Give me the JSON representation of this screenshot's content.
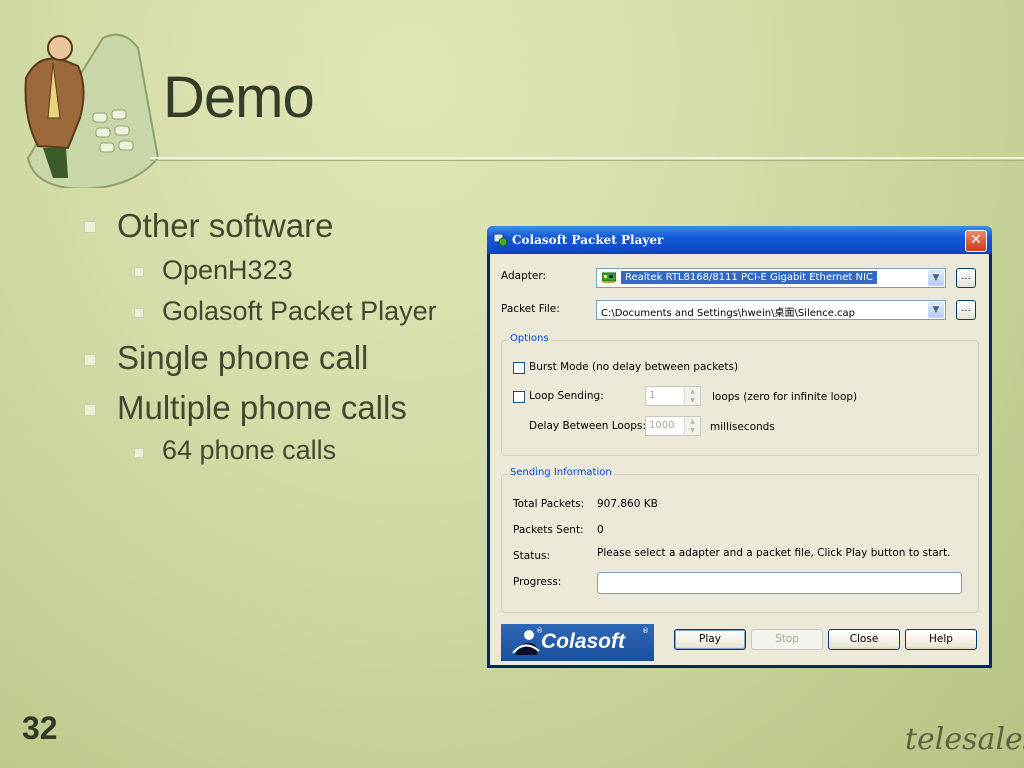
{
  "slide": {
    "title": "Demo",
    "page_number": "32",
    "brand": "telesales",
    "bullets": [
      {
        "text": "Other software",
        "children": [
          "OpenH323",
          "Golasoft Packet Player"
        ]
      },
      {
        "text": "Single phone call",
        "children": []
      },
      {
        "text": "Multiple phone calls",
        "children": [
          "64 phone calls"
        ]
      }
    ]
  },
  "dialog": {
    "title": "Colasoft Packet Player",
    "close_glyph": "✕",
    "adapter_label": "Adapter:",
    "adapter_value": "Realtek RTL8168/8111 PCI-E Gigabit Ethernet NIC",
    "packet_file_label": "Packet File:",
    "packet_file_value": "C:\\Documents and Settings\\hwein\\桌面\\Silence.cap",
    "browse_label": "...",
    "options_title": "Options",
    "burst_mode_label": "Burst Mode (no delay between packets)",
    "loop_sending_label": "Loop Sending:",
    "loops_value": "1",
    "loops_hint": "loops (zero for infinite loop)",
    "delay_label": "Delay Between Loops:",
    "delay_value": "1000",
    "delay_unit": "milliseconds",
    "sending_title": "Sending Information",
    "total_packets_label": "Total Packets:",
    "total_packets_value": "907.860 KB",
    "packets_sent_label": "Packets Sent:",
    "packets_sent_value": "0",
    "status_label": "Status:",
    "status_value": "Please select a adapter and a packet file, Click Play button to start.",
    "progress_label": "Progress:",
    "progress": 0,
    "logo_text": "Colasoft",
    "logo_reg": "®",
    "buttons": {
      "play": "Play",
      "stop": "Stop",
      "close": "Close",
      "help": "Help"
    }
  },
  "colors": {
    "titlebar": "#0a49c8",
    "dialog_bg": "#ece9d8",
    "accent": "#0046d5"
  }
}
